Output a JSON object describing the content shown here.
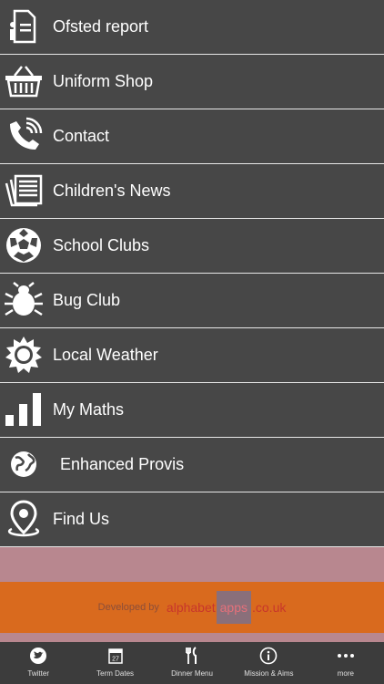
{
  "menu": {
    "items": [
      {
        "label": "Ofsted report",
        "icon": "report-icon"
      },
      {
        "label": "Uniform Shop",
        "icon": "basket-icon"
      },
      {
        "label": "Contact",
        "icon": "phone-icon"
      },
      {
        "label": "Children's News",
        "icon": "newspaper-icon"
      },
      {
        "label": "School Clubs",
        "icon": "football-icon"
      },
      {
        "label": "Bug Club",
        "icon": "bug-icon"
      },
      {
        "label": "Local Weather",
        "icon": "sun-icon"
      },
      {
        "label": "My Maths",
        "icon": "bar-chart-icon"
      },
      {
        "label": "Enhanced Provis",
        "icon": "globe-icon"
      },
      {
        "label": "Find Us",
        "icon": "location-pin-icon"
      }
    ]
  },
  "footer": {
    "developed_by": "Developed by",
    "brand_part1": "alphabet",
    "brand_part2": "apps",
    "brand_part3": ".co.uk"
  },
  "tabbar": {
    "tabs": [
      {
        "label": "Twitter",
        "icon": "twitter-icon"
      },
      {
        "label": "Term Dates",
        "icon": "calendar-icon",
        "badge": "27"
      },
      {
        "label": "Dinner Menu",
        "icon": "cutlery-icon"
      },
      {
        "label": "Mission & Aims",
        "icon": "info-icon"
      },
      {
        "label": "more",
        "icon": "more-icon"
      }
    ]
  },
  "colors": {
    "background": "#474747",
    "divider": "#e8e8e8",
    "orange_band": "#d96a1e",
    "pink_band": "#b8878f",
    "tabbar": "#3c3c3c"
  }
}
